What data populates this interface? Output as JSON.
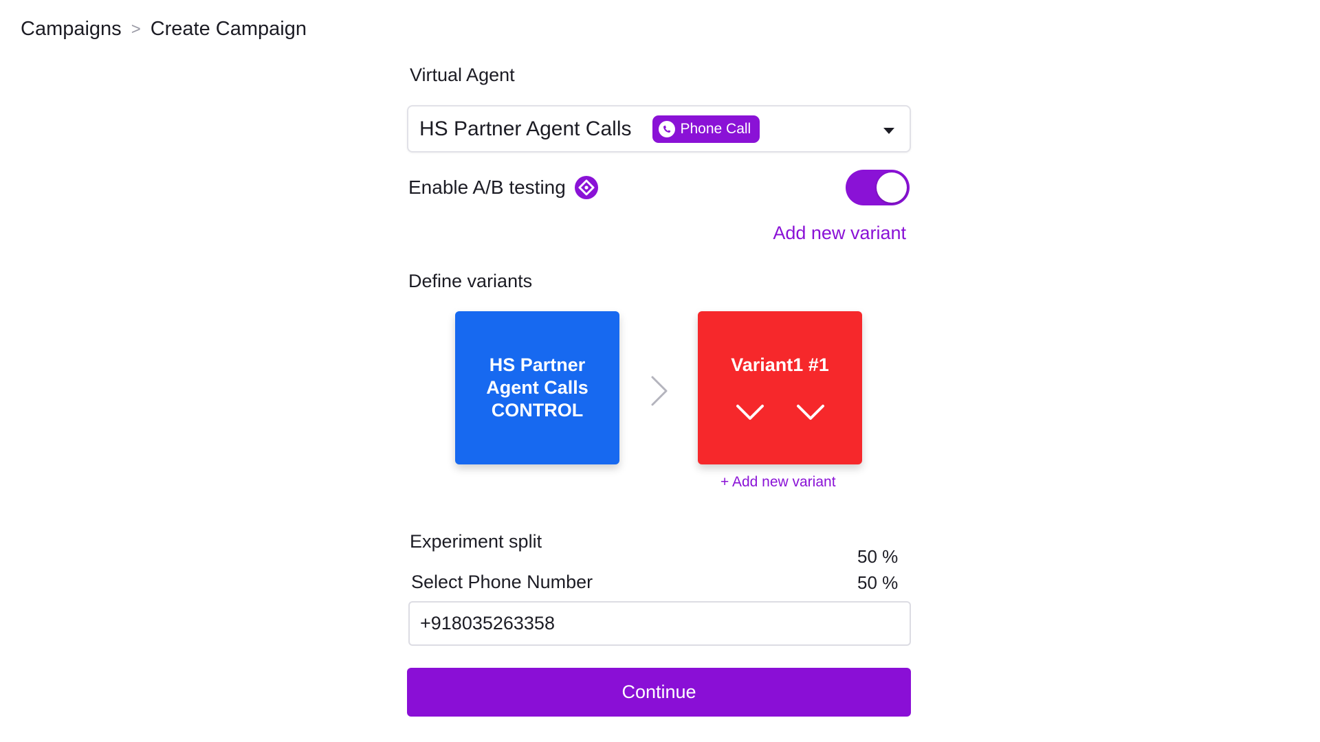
{
  "breadcrumb": {
    "root": "Campaigns",
    "separator": ">",
    "current": "Create Campaign"
  },
  "virtual_agent": {
    "label": "Virtual Agent",
    "selected": "HS Partner Agent Calls",
    "badge": "Phone Call",
    "badge_icon": "phone-call-icon"
  },
  "ab_testing": {
    "label": "Enable A/B testing",
    "info_icon": "info-diamond-icon",
    "enabled": true,
    "add_variant_link": "Add new variant"
  },
  "variants": {
    "label": "Define variants",
    "control": {
      "line1": "HS Partner",
      "line2": "Agent Calls",
      "line3": "CONTROL"
    },
    "variant": {
      "label": "Variant1 #1"
    },
    "add_link": "+ Add new variant"
  },
  "split": {
    "label": "Experiment split",
    "control_pct": "50 %",
    "variant_pct": "50 %"
  },
  "phone": {
    "label": "Select Phone Number",
    "value": "+918035263358"
  },
  "actions": {
    "continue": "Continue"
  },
  "colors": {
    "accent": "#8a12d6",
    "control": "#1769f0",
    "variant": "#f6282b"
  }
}
